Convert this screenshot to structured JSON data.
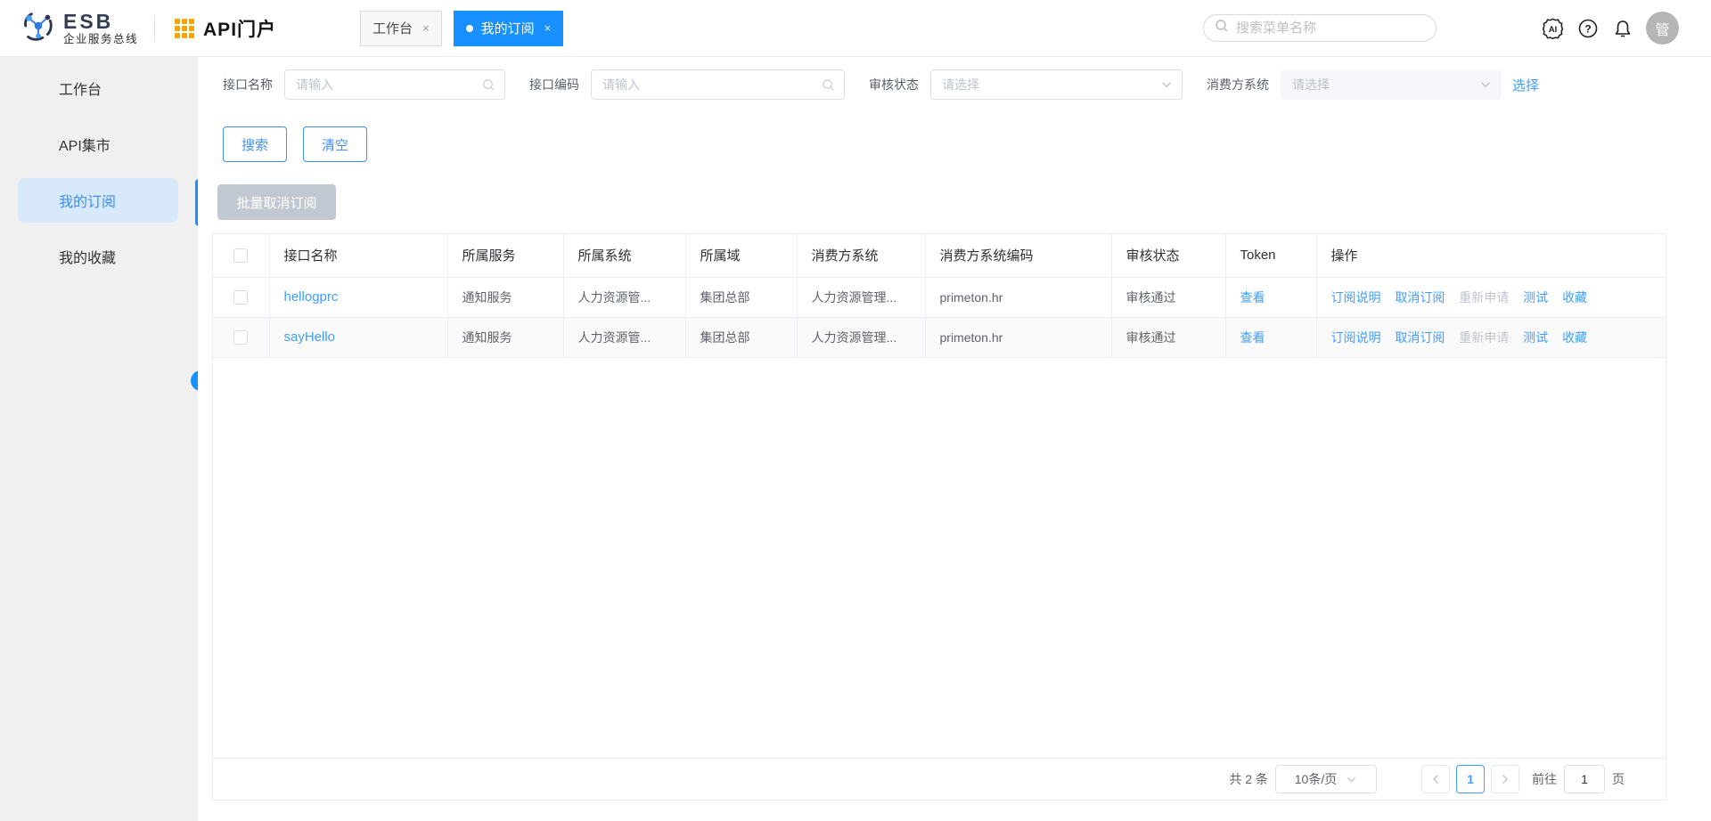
{
  "colors": {
    "primary_blue": "#1890ff",
    "link_blue": "#409eff",
    "logo_orange": "#f5a400",
    "sidebar_bg": "#f0f0f0",
    "active_item_bg": "#d8e9fb",
    "disabled_link": "#c0c4cc",
    "batch_disabled_bg": "#c2c8d2"
  },
  "header": {
    "logo_title": "ESB",
    "logo_subtitle": "企业服务总线",
    "portal_title": "API门户",
    "tabs": [
      {
        "label": "工作台",
        "active": false
      },
      {
        "label": "我的订阅",
        "active": true
      }
    ],
    "tab_close_glyph": "×",
    "search_placeholder": "搜索菜单名称",
    "ai_icon_label": "AI",
    "help_icon_label": "?",
    "avatar_label": "管"
  },
  "sidebar": {
    "items": [
      {
        "label": "工作台",
        "active": false
      },
      {
        "label": "API集市",
        "active": false
      },
      {
        "label": "我的订阅",
        "active": true
      },
      {
        "label": "我的收藏",
        "active": false
      }
    ]
  },
  "filters": {
    "interface_name": {
      "label": "接口名称",
      "placeholder": "请输入"
    },
    "interface_code": {
      "label": "接口编码",
      "placeholder": "请输入"
    },
    "audit_status": {
      "label": "审核状态",
      "placeholder": "请选择"
    },
    "consumer_system": {
      "label": "消费方系统",
      "placeholder": "请选择"
    },
    "select_link": "选择",
    "search_button": "搜索",
    "clear_button": "清空",
    "batch_cancel_button": "批量取消订阅"
  },
  "table": {
    "columns": [
      "接口名称",
      "所属服务",
      "所属系统",
      "所属域",
      "消费方系统",
      "消费方系统编码",
      "审核状态",
      "Token",
      "操作"
    ],
    "token_view": "查看",
    "actions": {
      "desc": "订阅说明",
      "cancel": "取消订阅",
      "reapply": "重新申请",
      "test": "测试",
      "favorite": "收藏"
    },
    "rows": [
      {
        "name": "hellogprc",
        "service": "通知服务",
        "system": "人力资源管...",
        "domain": "集团总部",
        "consumer": "人力资源管理...",
        "consumer_code": "primeton.hr",
        "status": "审核通过"
      },
      {
        "name": "sayHello",
        "service": "通知服务",
        "system": "人力资源管...",
        "domain": "集团总部",
        "consumer": "人力资源管理...",
        "consumer_code": "primeton.hr",
        "status": "审核通过"
      }
    ]
  },
  "pagination": {
    "total": "共 2 条",
    "page_size": "10条/页",
    "current_page": "1",
    "goto_label": "前往",
    "goto_value": "1",
    "page_unit": "页"
  }
}
